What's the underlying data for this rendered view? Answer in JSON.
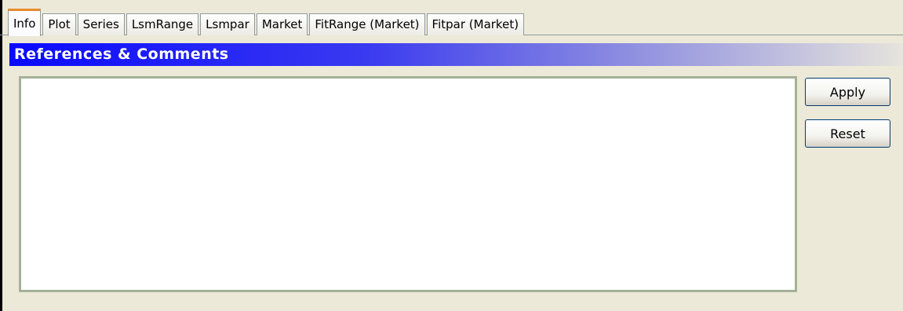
{
  "tabs": [
    {
      "label": "Info",
      "active": true
    },
    {
      "label": "Plot",
      "active": false
    },
    {
      "label": "Series",
      "active": false
    },
    {
      "label": "LsmRange",
      "active": false
    },
    {
      "label": "Lsmpar",
      "active": false
    },
    {
      "label": "Market",
      "active": false
    },
    {
      "label": "FitRange (Market)",
      "active": false
    },
    {
      "label": "Fitpar (Market)",
      "active": false
    }
  ],
  "section": {
    "title": "References & Comments"
  },
  "comments": {
    "value": "",
    "placeholder": ""
  },
  "buttons": {
    "apply_label": "Apply",
    "reset_label": "Reset"
  },
  "colors": {
    "header_gradient_start": "#0a0aff",
    "active_tab_accent": "#e68b2c",
    "window_background": "#ece9d8"
  }
}
